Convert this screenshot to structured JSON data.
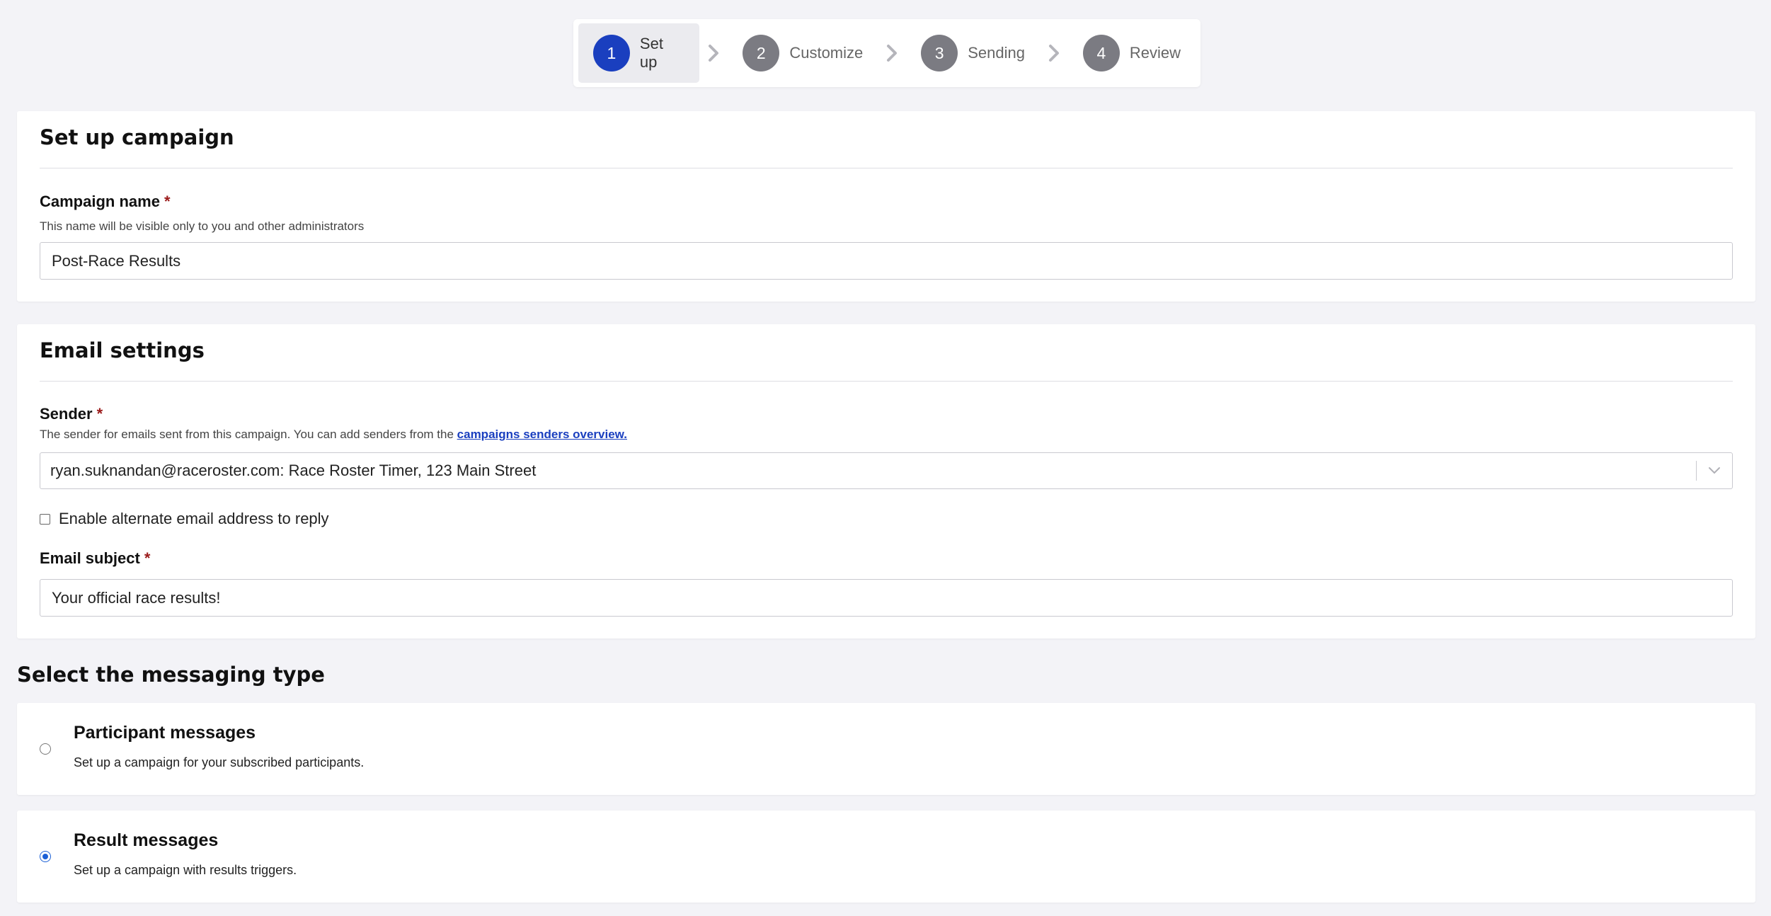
{
  "stepper": {
    "steps": [
      {
        "number": "1",
        "label": "Set up"
      },
      {
        "number": "2",
        "label": "Customize"
      },
      {
        "number": "3",
        "label": "Sending"
      },
      {
        "number": "4",
        "label": "Review"
      }
    ],
    "active_step": 1
  },
  "setup_card": {
    "title": "Set up campaign",
    "campaign_name": {
      "label": "Campaign name",
      "required_marker": "*",
      "help": "This name will be visible only to you and other administrators",
      "value": "Post-Race Results"
    }
  },
  "email_card": {
    "title": "Email settings",
    "sender": {
      "label": "Sender",
      "required_marker": "*",
      "help_prefix": "The sender for emails sent from this campaign. You can add senders from the ",
      "help_link": "campaigns senders overview.",
      "value": "ryan.suknandan@raceroster.com: Race Roster Timer, 123 Main Street"
    },
    "alternate_reply": {
      "label": "Enable alternate email address to reply",
      "checked": false
    },
    "subject": {
      "label": "Email subject",
      "required_marker": "*",
      "value": "Your official race results!"
    }
  },
  "messaging": {
    "heading": "Select the messaging type",
    "options": [
      {
        "title": "Participant messages",
        "description": "Set up a campaign for your subscribed participants.",
        "selected": false
      },
      {
        "title": "Result messages",
        "description": "Set up a campaign with results triggers.",
        "selected": true
      }
    ]
  },
  "colors": {
    "accent": "#1a3fbf",
    "required": "#9b1b1b",
    "background": "#f3f3f7"
  }
}
